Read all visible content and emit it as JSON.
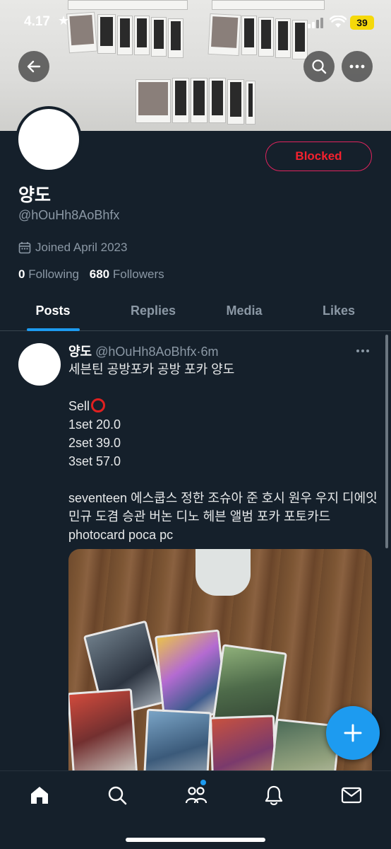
{
  "status_bar": {
    "time": "4.17",
    "star": "★",
    "battery": "39"
  },
  "profile": {
    "action_button": "Blocked",
    "display_name": "양도",
    "handle": "@hOuHh8AoBhfx",
    "joined": "Joined April 2023",
    "following_count": "0",
    "following_label": "Following",
    "followers_count": "680",
    "followers_label": "Followers"
  },
  "tabs": [
    {
      "label": "Posts",
      "active": true
    },
    {
      "label": "Replies",
      "active": false
    },
    {
      "label": "Media",
      "active": false
    },
    {
      "label": "Likes",
      "active": false
    }
  ],
  "post": {
    "author": "양도",
    "handle": "@hOuHh8AoBhfx",
    "separator": "·",
    "time": "6m",
    "lines": {
      "l1": "세븐틴 공방포카 공방 포카 양도",
      "sell": "Sell",
      "set1": "1set 20.0",
      "set2": "2set 39.0",
      "set3": "3set 57.0",
      "tags": "seventeen 에스쿱스 정한 조슈아 준 호시 원우 우지 디에잇 민규 도겸 승관 버논 디노 헤븐 앨범 포카 포토카드 photocard poca pc"
    }
  },
  "icons": {
    "back": "back-arrow-icon",
    "search": "search-icon",
    "more": "more-options-icon",
    "calendar": "calendar-icon",
    "compose": "plus-icon",
    "nav": [
      "home-icon",
      "search-icon",
      "communities-icon",
      "notifications-bell-icon",
      "messages-envelope-icon"
    ]
  },
  "colors": {
    "accent": "#1d9bf0",
    "background": "#15202b",
    "blocked": "#f4212e",
    "muted": "#8b98a5"
  }
}
